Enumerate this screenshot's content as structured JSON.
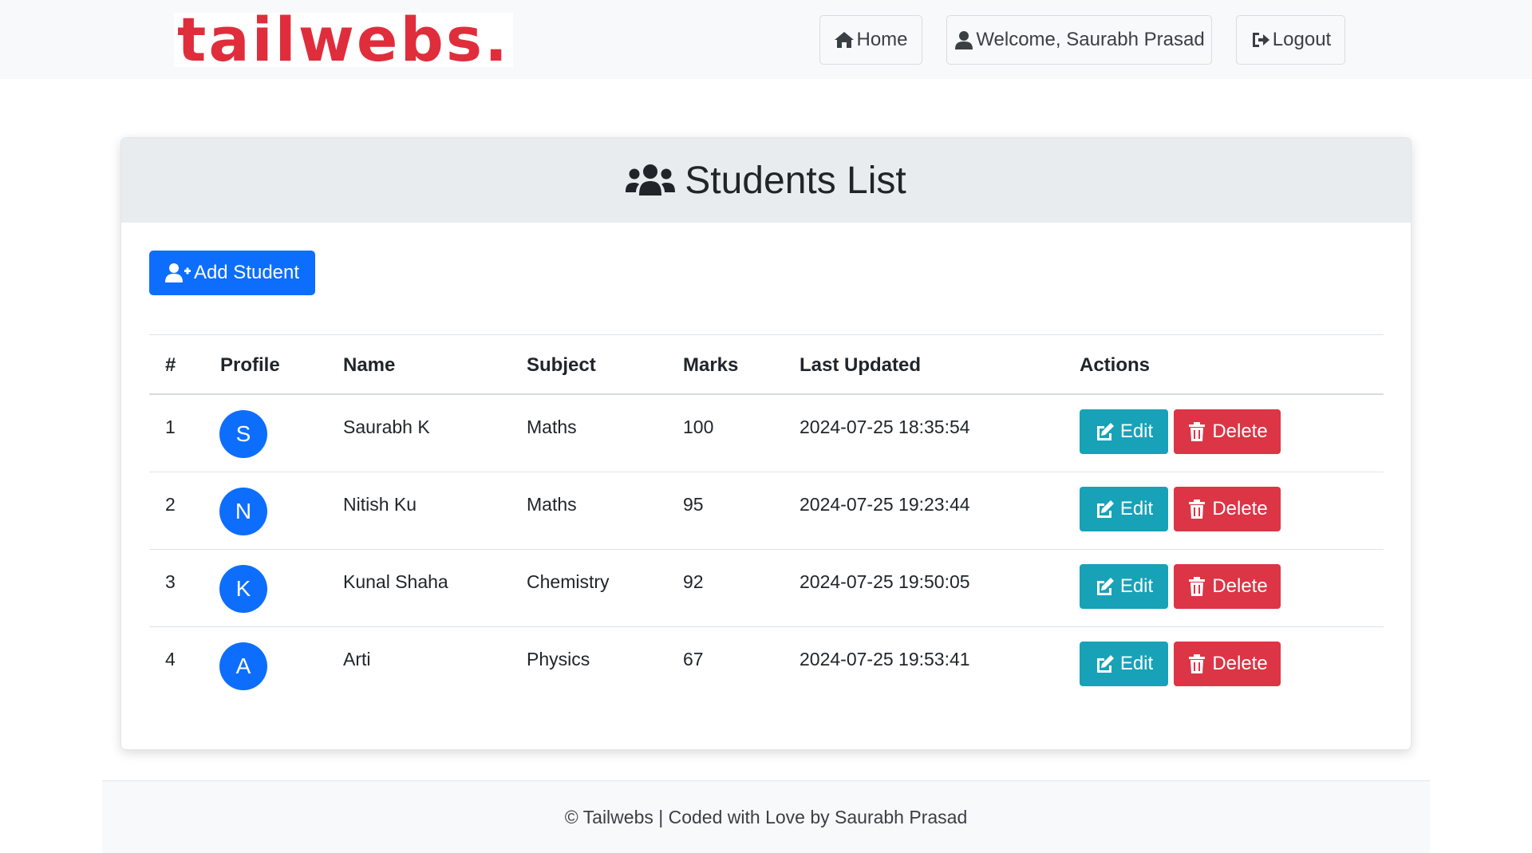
{
  "navbar": {
    "logo_text": "tailwebs.",
    "logo_color": "#e02d3c",
    "home_label": "Home",
    "home_icon": "home-icon",
    "welcome_label": "Welcome, Saurabh Prasad",
    "welcome_icon": "user-icon",
    "logout_label": "Logout",
    "logout_icon": "logout-icon"
  },
  "card": {
    "title": "Students List",
    "title_icon": "users-icon",
    "add_button_label": "Add Student",
    "add_button_icon": "user-plus-icon"
  },
  "table": {
    "headers": {
      "num": "#",
      "profile": "Profile",
      "name": "Name",
      "subject": "Subject",
      "marks": "Marks",
      "updated": "Last Updated",
      "actions": "Actions"
    },
    "rows": [
      {
        "num": "1",
        "initial": "S",
        "name": "Saurabh K",
        "subject": "Maths",
        "marks": "100",
        "updated": "2024-07-25 18:35:54",
        "edit": "Edit",
        "delete": "Delete"
      },
      {
        "num": "2",
        "initial": "N",
        "name": "Nitish Ku",
        "subject": "Maths",
        "marks": "95",
        "updated": "2024-07-25 19:23:44",
        "edit": "Edit",
        "delete": "Delete"
      },
      {
        "num": "3",
        "initial": "K",
        "name": "Kunal Shaha",
        "subject": "Chemistry",
        "marks": "92",
        "updated": "2024-07-25 19:50:05",
        "edit": "Edit",
        "delete": "Delete"
      },
      {
        "num": "4",
        "initial": "A",
        "name": "Arti",
        "subject": "Physics",
        "marks": "67",
        "updated": "2024-07-25 19:53:41",
        "edit": "Edit",
        "delete": "Delete"
      }
    ]
  },
  "footer": {
    "text": "© Tailwebs | Coded with Love by Saurabh Prasad"
  },
  "colors": {
    "primary": "#0d6efd",
    "edit": "#17a2b8",
    "delete": "#dc3545"
  }
}
